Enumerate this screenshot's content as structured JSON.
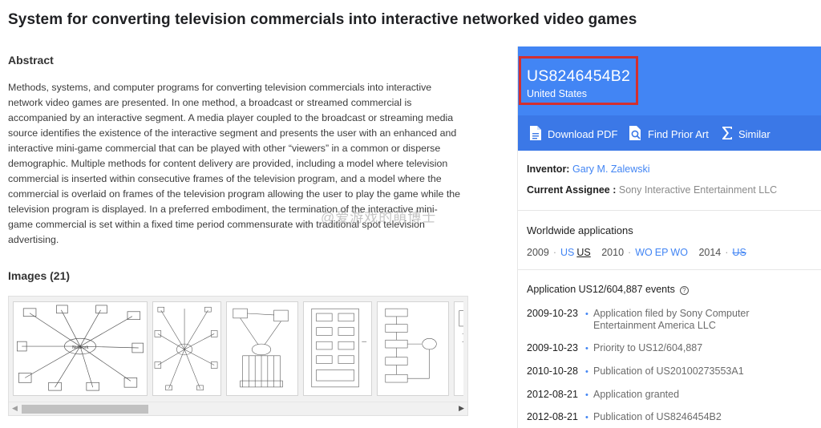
{
  "title": "System for converting television commercials into interactive networked video games",
  "abstract": {
    "heading": "Abstract",
    "text": "Methods, systems, and computer programs for converting television commercials into interactive network video games are presented. In one method, a broadcast or streamed commercial is accompanied by an interactive segment. A media player coupled to the broadcast or streaming media source identifies the existence of the interactive segment and presents the user with an enhanced and interactive mini-game commercial that can be played with other “viewers” in a common or disperse demographic. Multiple methods for content delivery are provided, including a model where television commercial is inserted within consecutive frames of the television program, and a model where the commercial is overlaid on frames of the television program allowing the user to play the game while the television program is displayed. In a preferred embodiment, the termination of the interactive mini-game commercial is set within a fixed time period commensurate with traditional spot television advertising."
  },
  "images": {
    "heading": "Images (21)"
  },
  "watermark": "@爱游戏的萌博士",
  "panel": {
    "patent_number": "US8246454B2",
    "country": "United States",
    "actions": {
      "download": "Download PDF",
      "prior_art": "Find Prior Art",
      "similar": "Similar"
    },
    "inventor_label": "Inventor:",
    "inventor": "Gary M. Zalewski",
    "assignee_label": "Current Assignee :",
    "assignee": "Sony Interactive Entertainment LLC",
    "worldwide_title": "Worldwide applications",
    "worldwide": {
      "y1": "2009",
      "y1_a": "US",
      "y1_b": "US",
      "y2": "2010",
      "y2_a": "WO",
      "y2_b": "EP",
      "y2_c": "WO",
      "y3": "2014",
      "y3_a": "US"
    },
    "events_title": "Application US12/604,887 events",
    "events": [
      {
        "date": "2009-10-23",
        "desc": "Application filed by Sony Computer",
        "desc2": "Entertainment America LLC"
      },
      {
        "date": "2009-10-23",
        "desc": "Priority to US12/604,887"
      },
      {
        "date": "2010-10-28",
        "desc": "Publication of US20100273553A1"
      },
      {
        "date": "2012-08-21",
        "desc": "Application granted"
      },
      {
        "date": "2012-08-21",
        "desc": "Publication of US8246454B2"
      }
    ]
  },
  "colors": {
    "accent": "#4285f4",
    "accent_dark": "#3b78e7",
    "highlight": "#d32f2f"
  }
}
